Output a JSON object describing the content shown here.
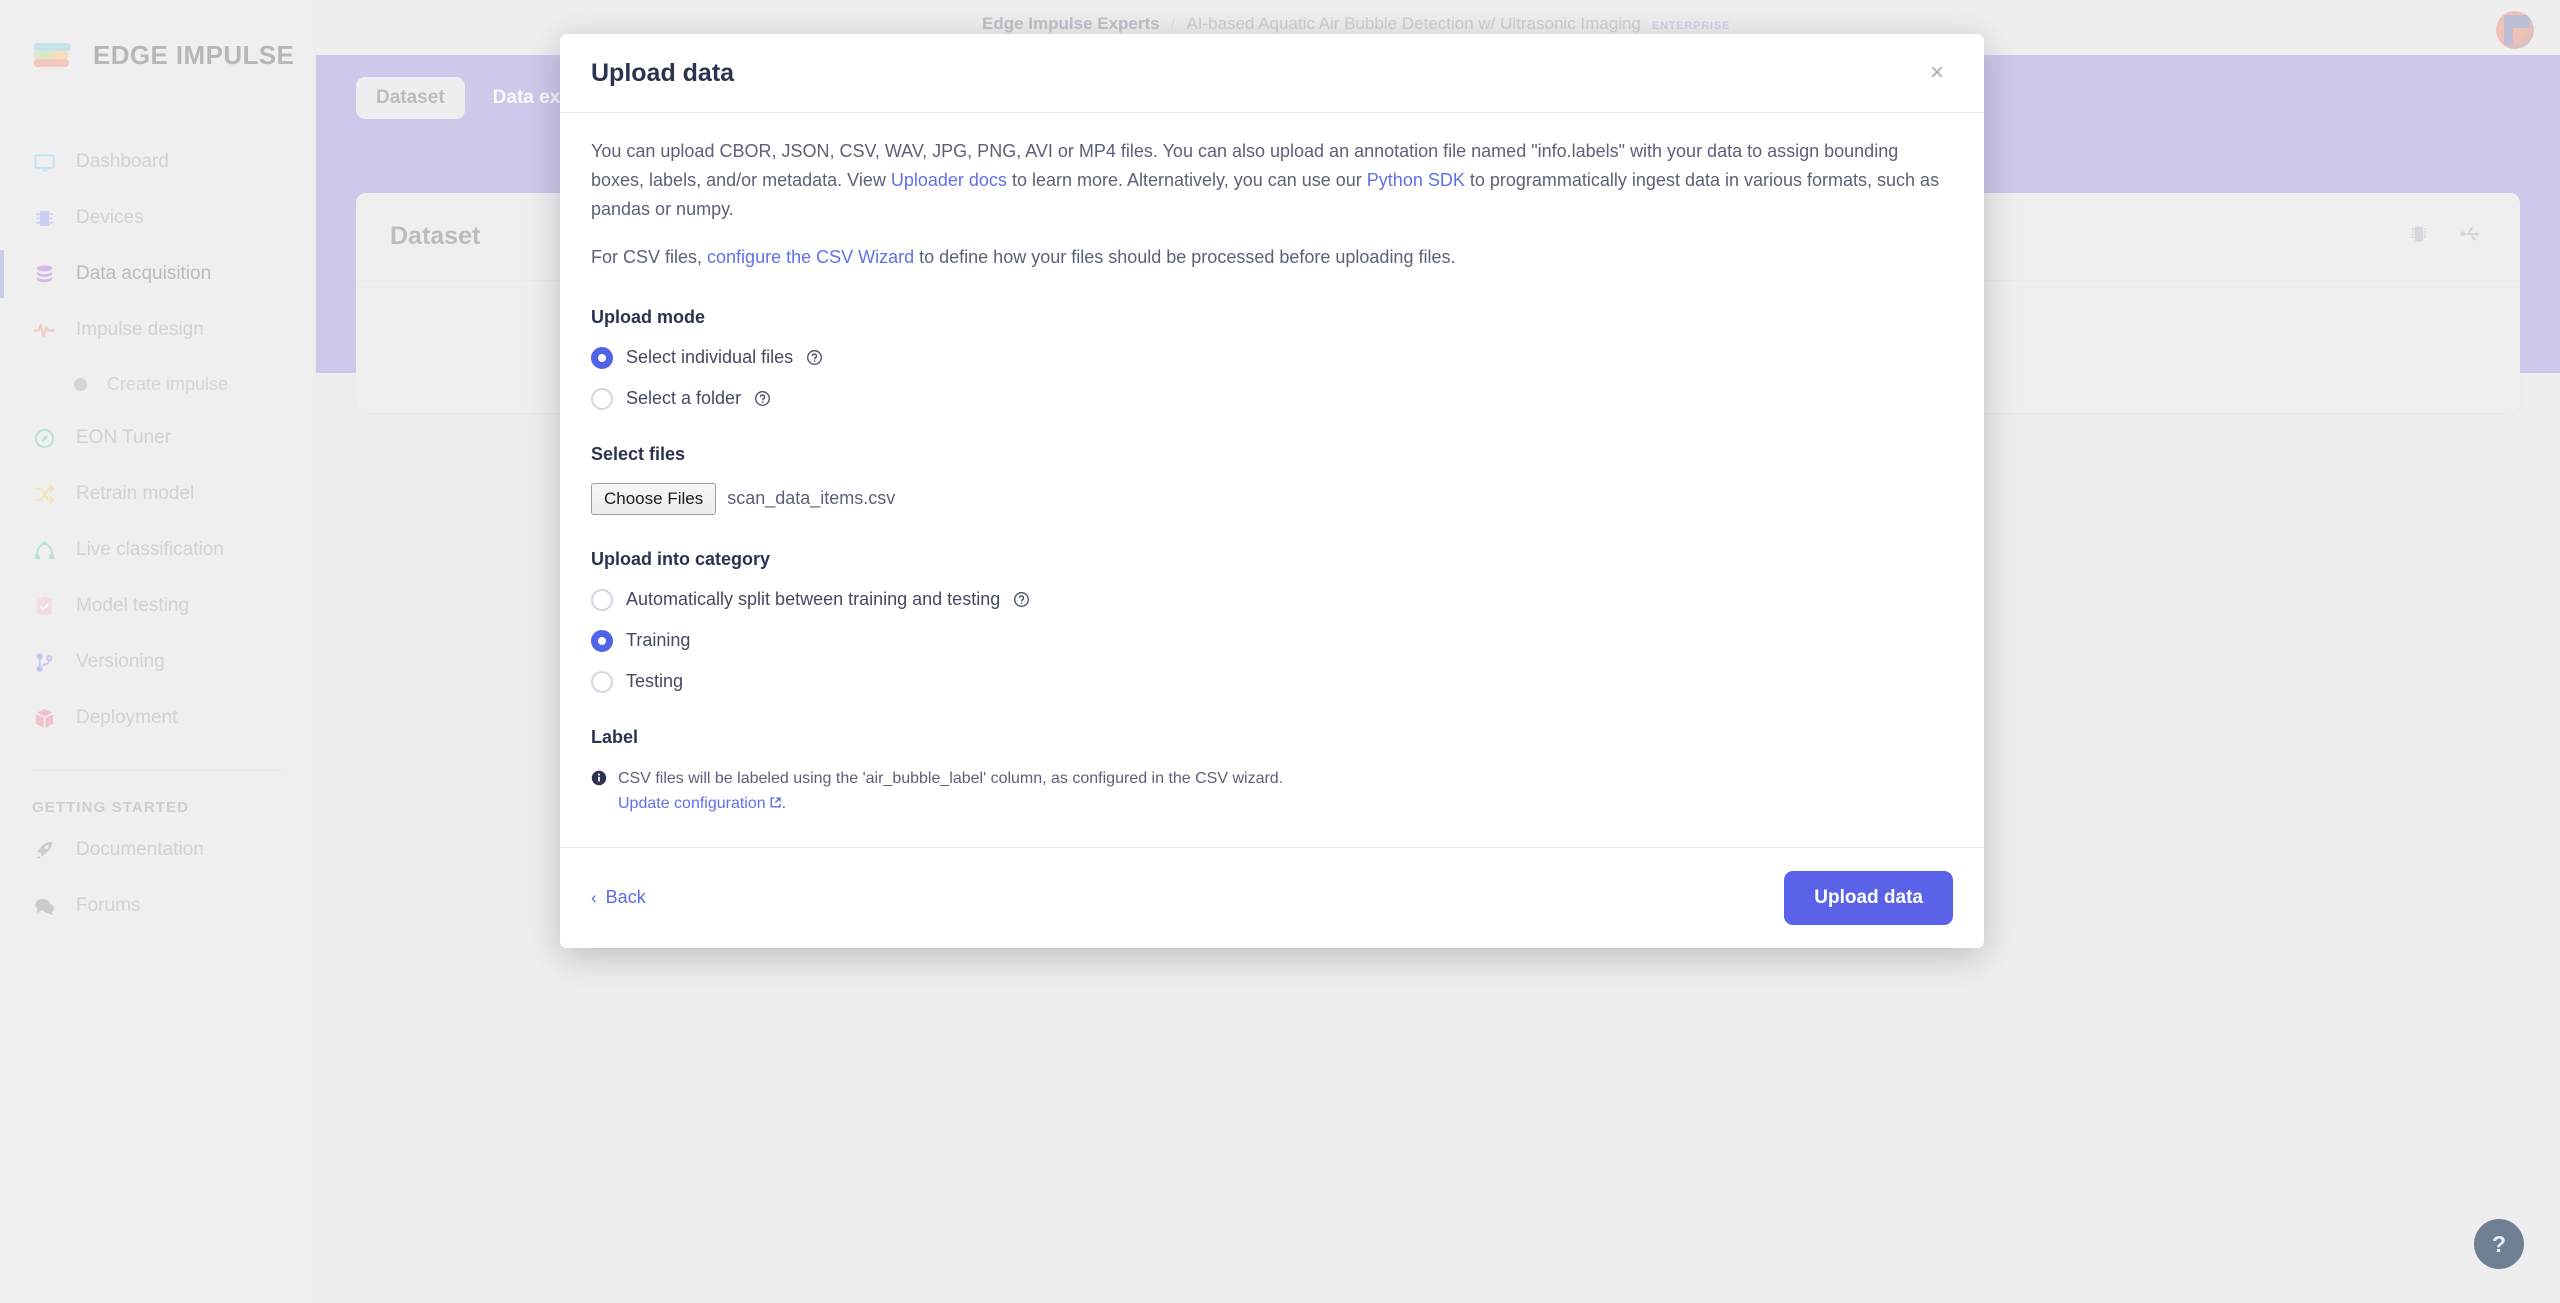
{
  "brand": {
    "name": "EDGE IMPULSE"
  },
  "sidebar": {
    "items": [
      {
        "label": "Dashboard",
        "icon": "monitor-icon",
        "active": false
      },
      {
        "label": "Devices",
        "icon": "chip-icon",
        "active": false
      },
      {
        "label": "Data acquisition",
        "icon": "database-icon",
        "active": true
      },
      {
        "label": "Impulse design",
        "icon": "waveform-icon",
        "active": false
      }
    ],
    "sub_items": [
      {
        "label": "Create impulse",
        "icon": "bullet-icon"
      }
    ],
    "items2": [
      {
        "label": "EON Tuner",
        "icon": "compass-icon"
      },
      {
        "label": "Retrain model",
        "icon": "shuffle-icon"
      },
      {
        "label": "Live classification",
        "icon": "classify-icon"
      },
      {
        "label": "Model testing",
        "icon": "clipboard-check-icon"
      },
      {
        "label": "Versioning",
        "icon": "branch-icon"
      },
      {
        "label": "Deployment",
        "icon": "box-icon"
      }
    ],
    "section_title": "GETTING STARTED",
    "footer_items": [
      {
        "label": "Documentation",
        "icon": "rocket-icon"
      },
      {
        "label": "Forums",
        "icon": "chat-icon"
      }
    ]
  },
  "breadcrumb": {
    "org": "Edge Impulse Experts",
    "separator": "/",
    "project": "AI-based Aquatic Air Bubble Detection w/ Ultrasonic Imaging",
    "badge": "ENTERPRISE"
  },
  "background": {
    "tabs": [
      {
        "label": "Dataset",
        "active": true
      },
      {
        "label": "Data explorer",
        "active": false
      }
    ],
    "panel_title": "Dataset",
    "panel_actions": [
      {
        "icon": "chip-device-icon"
      },
      {
        "icon": "usb-icon"
      }
    ]
  },
  "modal": {
    "title": "Upload data",
    "close_label": "×",
    "paragraph1": {
      "part1": "You can upload CBOR, JSON, CSV, WAV, JPG, PNG, AVI or MP4 files. You can also upload an annotation file named \"info.labels\" with your data to assign bounding boxes, labels, and/or metadata. View ",
      "link1": "Uploader docs",
      "part2": " to learn more. Alternatively, you can use our ",
      "link2": "Python SDK",
      "part3": " to programmatically ingest data in various formats, such as pandas or numpy."
    },
    "paragraph2": {
      "part1": "For CSV files, ",
      "link1": "configure the CSV Wizard",
      "part2": " to define how your files should be processed before uploading files."
    },
    "upload_mode": {
      "label": "Upload mode",
      "options": [
        {
          "label": "Select individual files",
          "checked": true,
          "help": true
        },
        {
          "label": "Select a folder",
          "checked": false,
          "help": true
        }
      ]
    },
    "select_files": {
      "label": "Select files",
      "button_label": "Choose Files",
      "file_name": "scan_data_items.csv"
    },
    "upload_category": {
      "label": "Upload into category",
      "options": [
        {
          "label": "Automatically split between training and testing",
          "checked": false,
          "help": true
        },
        {
          "label": "Training",
          "checked": true,
          "help": false
        },
        {
          "label": "Testing",
          "checked": false,
          "help": false
        }
      ]
    },
    "label_section": {
      "label": "Label",
      "note_part1": "CSV files will be labeled using the 'air_bubble_label' column, as configured in the CSV wizard. ",
      "note_link": "Update configuration",
      "note_part2": "."
    },
    "footer": {
      "back_label": "Back",
      "back_chevron": "‹",
      "upload_label": "Upload data"
    }
  },
  "help_fab": {
    "label": "?"
  },
  "colors": {
    "accent": "#5a63e8",
    "banner": "#6951c6",
    "link": "#6070e8",
    "sidebar_bg": "#d9d9d9"
  }
}
